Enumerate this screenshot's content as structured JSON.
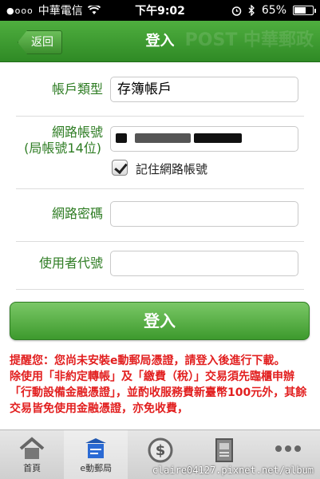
{
  "status_bar": {
    "signal": "●ooo",
    "carrier": "中華電信",
    "time": "下午9:02",
    "battery": "65%",
    "battery_level": 0.65
  },
  "nav": {
    "back_label": "返回",
    "title": "登入",
    "watermark_text": "POST 中華郵政"
  },
  "form": {
    "account_type_label": "帳戶類型",
    "account_type_value": "存簿帳戶",
    "net_account_label_line1": "網路帳號",
    "net_account_label_line2": "(局帳號14位)",
    "remember_label": "記住網路帳號",
    "password_label": "網路密碼",
    "user_code_label": "使用者代號"
  },
  "login_button": "登入",
  "notice": {
    "line1": "提醒您：您尚未安裝e動郵局憑證，請登入後進行下載。",
    "line2": "除使用「非約定轉帳」及「繳費（稅）」交易須先臨櫃申辦「行動設備金融憑證」，並酌收服務費新臺幣100元外，其餘交易皆免使用金融憑證，亦免收費，"
  },
  "tabs": [
    {
      "label": "首頁",
      "icon": "home-icon"
    },
    {
      "label": "e動郵局",
      "icon": "post-office-icon"
    },
    {
      "label": "",
      "icon": "dollar-icon"
    },
    {
      "label": "",
      "icon": "document-icon"
    },
    {
      "label": "",
      "icon": "more-icon"
    }
  ],
  "watermark_url": "claire04127.pixnet.net/album",
  "colors": {
    "accent_green": "#2f8a25",
    "notice_red": "#e21f1f"
  }
}
